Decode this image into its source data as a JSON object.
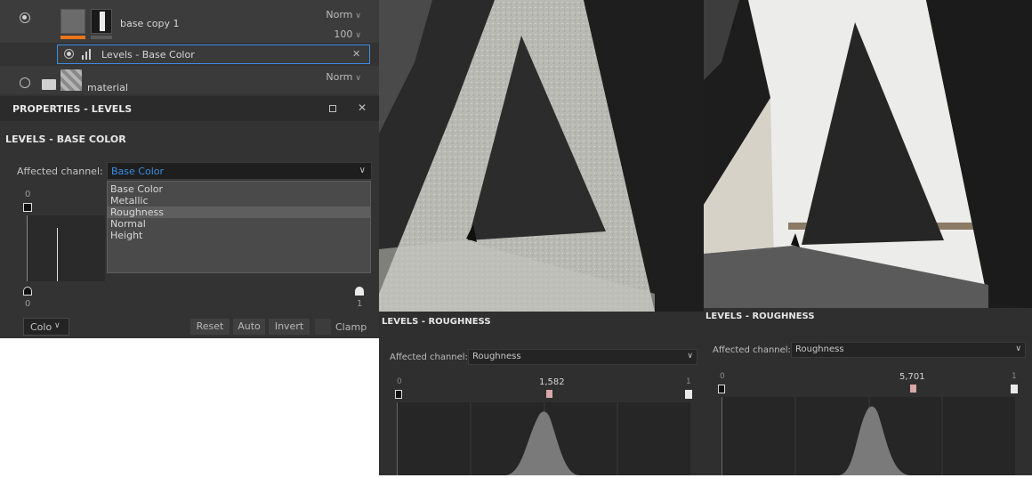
{
  "layers": {
    "row1": {
      "name": "base copy 1",
      "blend_mode": "Norm",
      "opacity": "100"
    },
    "row2": {
      "name": "Levels - Base Color"
    },
    "row3": {
      "name": "material",
      "blend_mode": "Norm"
    }
  },
  "properties": {
    "header_title": "PROPERTIES - LEVELS",
    "section_title": "LEVELS - BASE COLOR",
    "channel_label": "Affected channel:",
    "channel_value": "Base Color",
    "channel_options": [
      "Base Color",
      "Metallic",
      "Roughness",
      "Normal",
      "Height"
    ],
    "highlighted_option": "Roughness",
    "input_min_label": "0",
    "input_low_label": "0",
    "input_high_label": "1",
    "bottom_mode": "Colo",
    "buttons": {
      "reset": "Reset",
      "auto": "Auto",
      "invert": "Invert",
      "clamp": "Clamp"
    }
  },
  "viewport1": {
    "panel_title": "LEVELS - ROUGHNESS",
    "channel_label": "Affected channel:",
    "channel_value": "Roughness",
    "min_label": "0",
    "mid_value": "1,582",
    "max_label": "1"
  },
  "viewport2": {
    "panel_title": "LEVELS - ROUGHNESS",
    "channel_label": "Affected channel:",
    "channel_value": "Roughness",
    "min_label": "0",
    "mid_value": "5,701",
    "max_label": "1"
  },
  "colors": {
    "panel_bg": "#333333",
    "accent_blue": "#3a8ee6",
    "orange": "#e8761e",
    "mid_marker": "#d8a8a8"
  },
  "icons": {
    "eye": "eye-icon",
    "levels": "levels-icon",
    "close": "close-icon",
    "folder": "folder-icon",
    "undock": "undock-icon"
  }
}
